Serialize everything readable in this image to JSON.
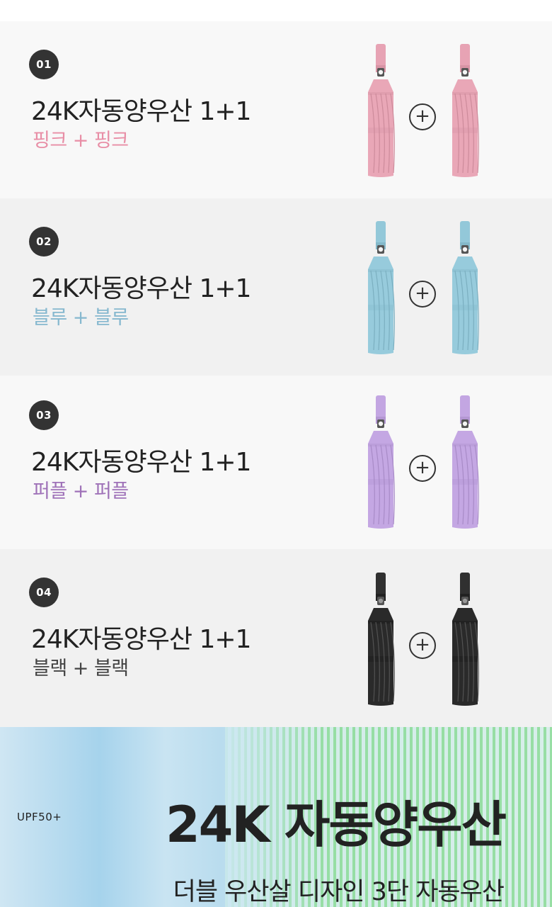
{
  "options": [
    {
      "num": "01",
      "title": "24K자동양우산 1+1",
      "colors": "핑크 + 핑크",
      "color_hex": "#e88ea6",
      "umbrella_hex": "#e9a7b7",
      "handle_hex": "#e7a3b4",
      "dark": false
    },
    {
      "num": "02",
      "title": "24K자동양우산 1+1",
      "colors": "블루 + 블루",
      "color_hex": "#86b8cf",
      "umbrella_hex": "#97cbdc",
      "handle_hex": "#93c8d9",
      "dark": false
    },
    {
      "num": "03",
      "title": "24K자동양우산 1+1",
      "colors": "퍼플 + 퍼플",
      "color_hex": "#9f72b8",
      "umbrella_hex": "#c4a7e3",
      "handle_hex": "#c3a6e2",
      "dark": false
    },
    {
      "num": "04",
      "title": "24K자동양우산 1+1",
      "colors": "블랙 + 블랙",
      "color_hex": "#444444",
      "umbrella_hex": "#2a2a2a",
      "handle_hex": "#303030",
      "dark": true
    }
  ],
  "plus_icon": "plus-circle-icon",
  "banner": {
    "badge": "UPF50+",
    "title": "24K 자동양우산",
    "subtitle": "더블 우산살 디자인 3단 자동우산"
  }
}
